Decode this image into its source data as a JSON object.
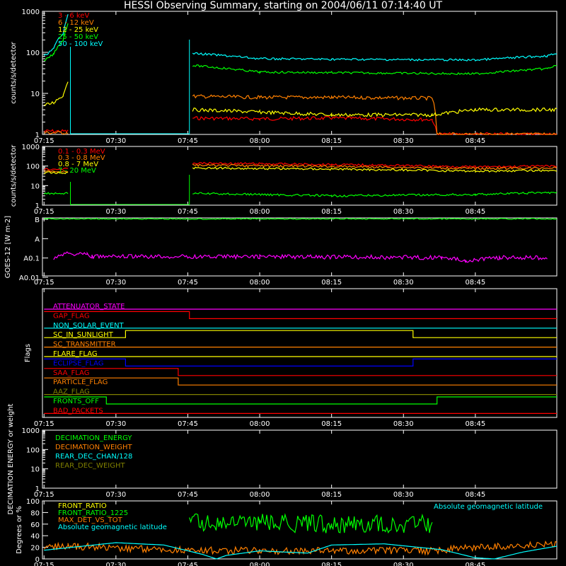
{
  "title": "HESSI Observing Summary, starting on 2004/06/11 07:14:40 UT",
  "chart_data": [
    {
      "id": "panel1",
      "type": "line",
      "ylabel": "counts/s/detector",
      "yscale": "log",
      "ylim": [
        1,
        1000
      ],
      "yticks": [
        "1",
        "10",
        "100",
        "1000"
      ],
      "x_ticks": [
        "07:15",
        "07:30",
        "07:45",
        "08:00",
        "08:15",
        "08:30",
        "08:45"
      ],
      "gap": [
        "07:20:30",
        "07:45:20"
      ],
      "series": [
        {
          "name": "3 - 6 keV",
          "color": "#ff0000",
          "points": [
            [
              "07:15",
              1.2
            ],
            [
              "07:20",
              1.2
            ],
            [
              "07:46",
              2.5
            ],
            [
              "08:00",
              2.4
            ],
            [
              "08:15",
              2.5
            ],
            [
              "08:36",
              2.3
            ],
            [
              "08:37",
              1.0
            ],
            [
              "09:02",
              1.0
            ]
          ]
        },
        {
          "name": "6 - 12 keV",
          "color": "#ff8000",
          "points": [
            [
              "07:15",
              1.1
            ],
            [
              "07:20",
              1.1
            ],
            [
              "07:46",
              8.5
            ],
            [
              "08:00",
              8.0
            ],
            [
              "08:15",
              8.0
            ],
            [
              "08:36",
              7.6
            ],
            [
              "08:37",
              1.0
            ],
            [
              "09:02",
              1.0
            ]
          ]
        },
        {
          "name": "12 - 25 keV",
          "color": "#ffff00",
          "points": [
            [
              "07:15",
              5.0
            ],
            [
              "07:17",
              6.0
            ],
            [
              "07:19",
              9.0
            ],
            [
              "07:20",
              20
            ],
            [
              "07:46",
              4.0
            ],
            [
              "08:00",
              3.5
            ],
            [
              "08:15",
              3.0
            ],
            [
              "08:36",
              3.0
            ],
            [
              "08:45",
              4.0
            ],
            [
              "09:02",
              4.0
            ]
          ]
        },
        {
          "name": "25 - 50 keV",
          "color": "#00ff00",
          "points": [
            [
              "07:15",
              60
            ],
            [
              "07:17",
              90
            ],
            [
              "07:19",
              200
            ],
            [
              "07:20",
              500
            ],
            [
              "07:46",
              48
            ],
            [
              "08:00",
              33
            ],
            [
              "08:15",
              32
            ],
            [
              "08:45",
              30
            ],
            [
              "09:00",
              40
            ],
            [
              "09:02",
              48
            ]
          ]
        },
        {
          "name": "50 - 100 keV",
          "color": "#00ffff",
          "points": [
            [
              "07:15",
              80
            ],
            [
              "07:17",
              120
            ],
            [
              "07:19",
              300
            ],
            [
              "07:20",
              800
            ],
            [
              "07:46",
              95
            ],
            [
              "08:00",
              70
            ],
            [
              "08:15",
              68
            ],
            [
              "08:45",
              65
            ],
            [
              "09:00",
              82
            ],
            [
              "09:02",
              95
            ]
          ]
        }
      ]
    },
    {
      "id": "panel2",
      "type": "line",
      "ylabel": "counts/s/detector",
      "yscale": "log",
      "ylim": [
        1,
        1000
      ],
      "yticks": [
        "1",
        "10",
        "100",
        "1000"
      ],
      "x_ticks": [
        "07:15",
        "07:30",
        "07:45",
        "08:00",
        "08:15",
        "08:30",
        "08:45"
      ],
      "gap": [
        "07:20:30",
        "07:45:20"
      ],
      "series": [
        {
          "name": "0.1 - 0.3 MeV",
          "color": "#ff0000",
          "points": [
            [
              "07:15",
              70
            ],
            [
              "07:20",
              70
            ],
            [
              "07:46",
              140
            ],
            [
              "08:15",
              120
            ],
            [
              "08:45",
              90
            ],
            [
              "09:02",
              100
            ]
          ]
        },
        {
          "name": "0.3 - 0.8 MeV",
          "color": "#ff8000",
          "points": [
            [
              "07:15",
              55
            ],
            [
              "07:20",
              55
            ],
            [
              "07:46",
              110
            ],
            [
              "08:15",
              95
            ],
            [
              "08:45",
              75
            ],
            [
              "09:02",
              80
            ]
          ]
        },
        {
          "name": "0.8 - 7 MeV",
          "color": "#ffff00",
          "points": [
            [
              "07:15",
              45
            ],
            [
              "07:20",
              45
            ],
            [
              "07:46",
              80
            ],
            [
              "08:15",
              70
            ],
            [
              "08:45",
              55
            ],
            [
              "09:02",
              60
            ]
          ]
        },
        {
          "name": "7 - 20 MeV",
          "color": "#00ff00",
          "points": [
            [
              "07:15",
              4
            ],
            [
              "07:20",
              4
            ],
            [
              "07:46",
              4
            ],
            [
              "08:15",
              3
            ],
            [
              "08:45",
              3.5
            ],
            [
              "09:02",
              4.5
            ]
          ]
        }
      ]
    },
    {
      "id": "panel3",
      "type": "line",
      "ylabel": "GOES-12 [W m-2]",
      "yticks": [
        "A0.01",
        "A0.1",
        "A",
        "B"
      ],
      "ylim": [
        -10,
        -7
      ],
      "x_ticks": [
        "07:15",
        "07:30",
        "07:45",
        "08:00",
        "08:15",
        "08:30",
        "08:45"
      ],
      "series": [
        {
          "name": "GOES 1-8 A",
          "color": "#00ff00",
          "points": [
            [
              "07:15",
              -7.05
            ],
            [
              "09:02",
              -7.05
            ]
          ]
        },
        {
          "name": "GOES 0.5-4 A",
          "color": "#ff00ff",
          "points": [
            [
              "07:17",
              -9.2
            ],
            [
              "07:18",
              -8.85
            ],
            [
              "07:24",
              -8.85
            ],
            [
              "07:25",
              -9.0
            ],
            [
              "08:00",
              -9.0
            ],
            [
              "08:38",
              -9.05
            ],
            [
              "08:43",
              -9.2
            ],
            [
              "08:50",
              -9.05
            ],
            [
              "09:00",
              -9.05
            ]
          ]
        }
      ]
    },
    {
      "id": "panel4",
      "type": "line",
      "ylabel": "Flags",
      "x_ticks": [
        "07:15",
        "07:30",
        "07:45",
        "08:00",
        "08:15",
        "08:30",
        "08:45"
      ],
      "flags": [
        {
          "name": "ATTENUATOR_STATE",
          "color": "#ff00ff",
          "steps": [
            [
              "07:15",
              0
            ],
            [
              "09:02",
              0
            ]
          ]
        },
        {
          "name": "GAP_FLAG",
          "color": "#ff0000",
          "steps": [
            [
              "07:15",
              1
            ],
            [
              "07:45:20",
              0
            ],
            [
              "09:02",
              0
            ]
          ]
        },
        {
          "name": "NON_SOLAR_EVENT",
          "color": "#00ffff",
          "steps": [
            [
              "07:15",
              0
            ],
            [
              "09:02",
              0
            ]
          ]
        },
        {
          "name": "SC_IN_SUNLIGHT",
          "color": "#ffff00",
          "steps": [
            [
              "07:15",
              0
            ],
            [
              "07:32",
              1
            ],
            [
              "08:32",
              0
            ],
            [
              "09:02",
              0
            ]
          ]
        },
        {
          "name": "SC_TRANSMITTER",
          "color": "#ff8000",
          "steps": [
            [
              "07:15",
              0
            ],
            [
              "09:02",
              0
            ]
          ]
        },
        {
          "name": "FLARE_FLAG",
          "color": "#ffff00",
          "steps": [
            [
              "07:15",
              0
            ],
            [
              "09:02",
              0
            ]
          ]
        },
        {
          "name": "ECLIPSE_FLAG",
          "color": "#0000ff",
          "steps": [
            [
              "07:15",
              1
            ],
            [
              "07:32",
              0
            ],
            [
              "08:32",
              1
            ],
            [
              "09:02",
              1
            ]
          ]
        },
        {
          "name": "SAA_FLAG",
          "color": "#ff0000",
          "steps": [
            [
              "07:15",
              1
            ],
            [
              "07:43",
              0
            ],
            [
              "09:02",
              0
            ]
          ]
        },
        {
          "name": "PARTICLE_FLAG",
          "color": "#ff8000",
          "steps": [
            [
              "07:15",
              1
            ],
            [
              "07:43",
              0
            ],
            [
              "09:02",
              0
            ]
          ]
        },
        {
          "name": "AAZ_FLAG",
          "color": "#808000",
          "steps": [
            [
              "07:15",
              0
            ],
            [
              "09:02",
              0
            ]
          ]
        },
        {
          "name": "FRONTS_OFF",
          "color": "#00ff00",
          "steps": [
            [
              "07:15",
              1
            ],
            [
              "07:28",
              0
            ],
            [
              "08:37",
              1
            ],
            [
              "09:02",
              1
            ]
          ]
        },
        {
          "name": "BAD_PACKETS",
          "color": "#ff0000",
          "steps": [
            [
              "07:15",
              0
            ],
            [
              "09:02",
              0
            ]
          ]
        }
      ]
    },
    {
      "id": "panel5",
      "type": "line",
      "ylabel": "DECIMATION ENERGY or weight",
      "yscale": "log",
      "ylim": [
        1,
        1000
      ],
      "yticks": [
        "1",
        "10",
        "100",
        "1000"
      ],
      "x_ticks": [
        "07:15",
        "07:30",
        "07:45",
        "08:00",
        "08:15",
        "08:30",
        "08:45"
      ],
      "series": [
        {
          "name": "DECIMATION_ENERGY",
          "color": "#00ff00",
          "points": []
        },
        {
          "name": "DECIMATION_WEIGHT",
          "color": "#ff8000",
          "points": []
        },
        {
          "name": "REAR_DEC_CHAN/128",
          "color": "#00ffff",
          "points": []
        },
        {
          "name": "REAR_DEC_WEIGHT",
          "color": "#808000",
          "points": []
        }
      ]
    },
    {
      "id": "panel6",
      "type": "line",
      "ylabel": "Degrees or %",
      "ylim": [
        0,
        100
      ],
      "yticks": [
        "0",
        "20",
        "40",
        "60",
        "80",
        "100"
      ],
      "x_ticks": [
        "07:15",
        "07:30",
        "07:45",
        "08:00",
        "08:15",
        "08:30",
        "08:45"
      ],
      "annotation": "Absolute geomagnetic latitude",
      "series": [
        {
          "name": "FRONT_RATIO",
          "color": "#ffff00",
          "points": []
        },
        {
          "name": "FRONT_RATIO_1225",
          "color": "#00ff00",
          "points": [
            [
              "07:45:20",
              62
            ],
            [
              "08:00",
              62
            ],
            [
              "08:15",
              60
            ],
            [
              "08:36",
              60
            ]
          ]
        },
        {
          "name": "MAX_DET_VS_TOT",
          "color": "#ff8000",
          "points": [
            [
              "07:15",
              20
            ],
            [
              "07:20",
              22
            ],
            [
              "07:46",
              15
            ],
            [
              "08:00",
              14
            ],
            [
              "08:36",
              14
            ],
            [
              "08:45",
              20
            ],
            [
              "09:02",
              25
            ]
          ]
        },
        {
          "name": "Absolute geomagnetic latitude",
          "color": "#00ffff",
          "points": [
            [
              "07:15",
              15
            ],
            [
              "07:30",
              28
            ],
            [
              "07:40",
              24
            ],
            [
              "07:48",
              8
            ],
            [
              "07:51",
              0
            ],
            [
              "07:53",
              6
            ],
            [
              "08:00",
              14
            ],
            [
              "08:10",
              10
            ],
            [
              "08:15",
              24
            ],
            [
              "08:26",
              26
            ],
            [
              "08:38",
              16
            ],
            [
              "08:45",
              2
            ],
            [
              "08:49",
              0
            ],
            [
              "08:55",
              12
            ],
            [
              "09:02",
              22
            ]
          ]
        }
      ]
    }
  ]
}
